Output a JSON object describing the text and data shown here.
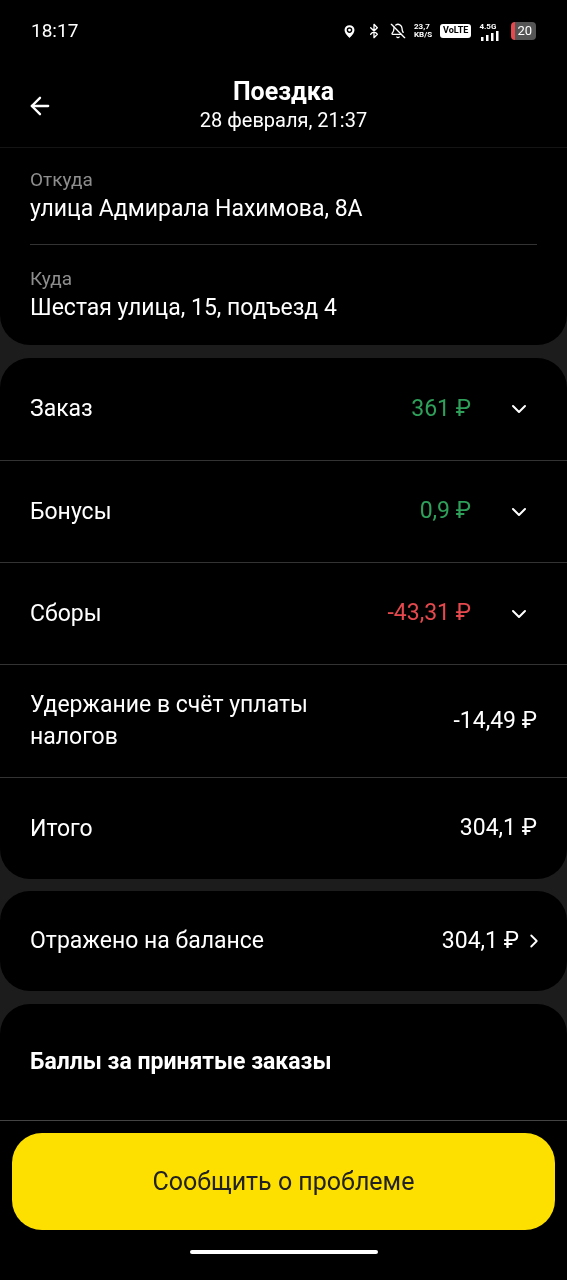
{
  "status_bar": {
    "time": "18:17",
    "speed": [
      "23,7",
      "KB/S"
    ],
    "volte": "VoLTE",
    "network": "4.5G",
    "battery": "20"
  },
  "header": {
    "title": "Поездка",
    "subtitle": "28 февраля, 21:37"
  },
  "route": [
    {
      "label": "Откуда",
      "value": "улица Адмирала Нахимова, 8А"
    },
    {
      "label": "Куда",
      "value": "Шестая улица, 15, подъезд 4"
    }
  ],
  "finance": [
    {
      "kind": "expandable",
      "label": "Заказ",
      "amount": "361 ₽",
      "color": "#2ea05a"
    },
    {
      "kind": "expandable",
      "label": "Бонусы",
      "amount": "0,9 ₽",
      "color": "#2ea05a"
    },
    {
      "kind": "expandable",
      "label": "Сборы",
      "amount": "-43,31 ₽",
      "color": "#e5484d"
    },
    {
      "kind": "plain",
      "label": "Удержание в счёт уплаты налогов",
      "amount": "-14,49 ₽",
      "color": "#ffffff"
    },
    {
      "kind": "plain",
      "label": "Итого",
      "amount": "304,1 ₽",
      "color": "#ffffff"
    }
  ],
  "balance": {
    "label": "Отражено на балансе",
    "amount": "304,1 ₽"
  },
  "points": {
    "title": "Баллы за принятые заказы"
  },
  "action_button": "Сообщить о проблеме"
}
